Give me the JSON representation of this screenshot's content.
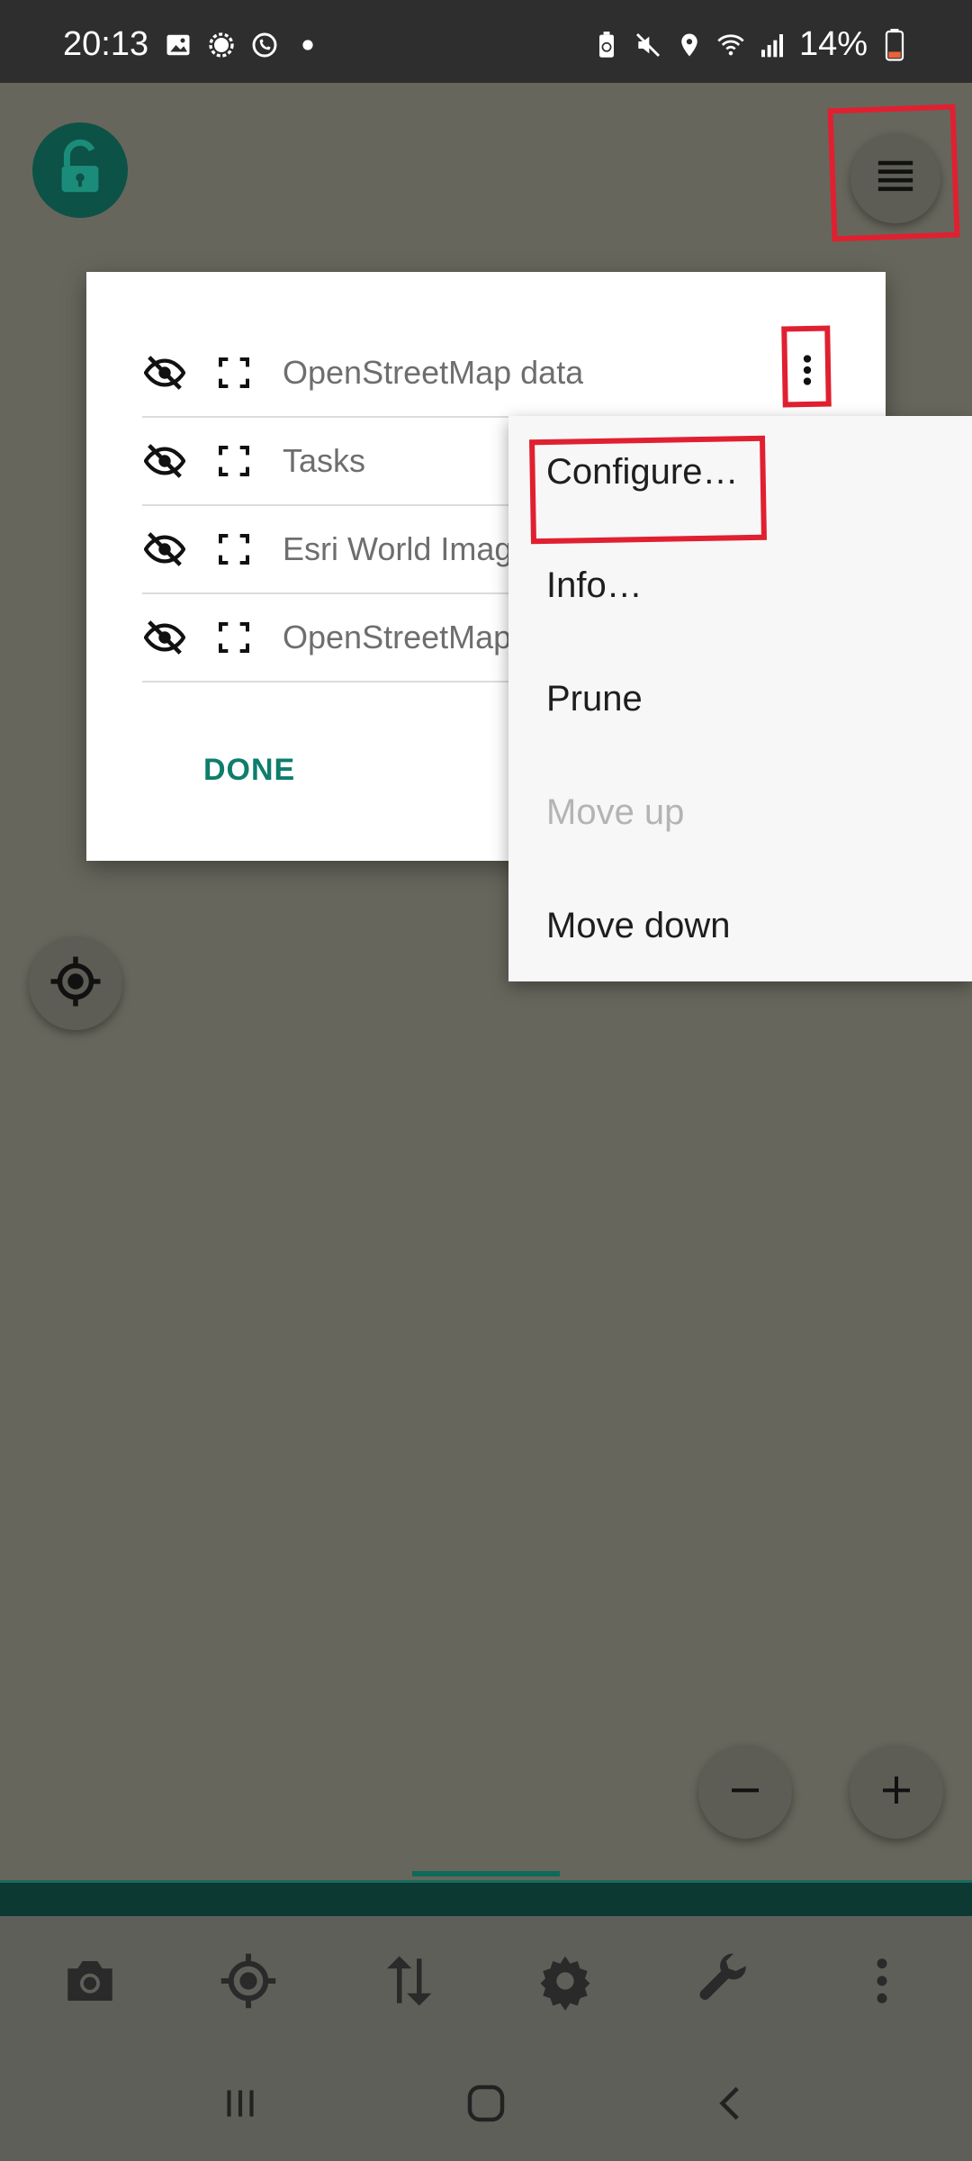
{
  "status_bar": {
    "time": "20:13",
    "battery": "14%",
    "left_icons": [
      "gallery-icon",
      "signal-app-icon",
      "whatsapp-icon",
      "dot-icon"
    ],
    "right_icons": [
      "battery-saver-icon",
      "mute-icon",
      "location-icon",
      "wifi-icon",
      "cell-signal-icon",
      "battery-icon"
    ]
  },
  "dialog": {
    "layers": [
      {
        "name": "OpenStreetMap data"
      },
      {
        "name": "Tasks"
      },
      {
        "name": "Esri World Imag"
      },
      {
        "name": "OpenStreetMap"
      }
    ],
    "done_label": "DONE"
  },
  "layer_menu": {
    "items": [
      {
        "label": "Configure…",
        "enabled": true
      },
      {
        "label": "Info…",
        "enabled": true
      },
      {
        "label": "Prune",
        "enabled": true
      },
      {
        "label": "Move up",
        "enabled": false
      },
      {
        "label": "Move down",
        "enabled": true
      }
    ]
  },
  "toolbar": {
    "icons": [
      "camera-icon",
      "gps-icon",
      "transfer-icon",
      "settings-icon",
      "tools-icon",
      "more-icon"
    ]
  },
  "colors": {
    "accent": "#0f7d6c",
    "highlight": "#e02030",
    "map_bg": "#66665c",
    "lock_bg": "#0d5247"
  }
}
